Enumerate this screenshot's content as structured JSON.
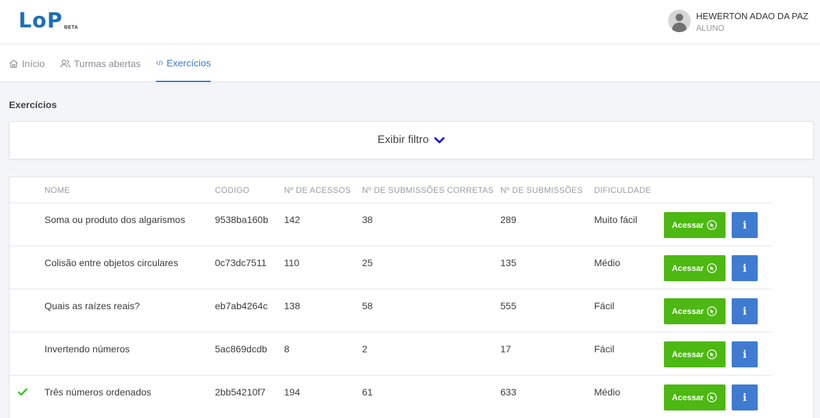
{
  "header": {
    "logo": "LoP",
    "logo_badge": "BETA",
    "user_name": "HEWERTON ADAO DA PAZ",
    "user_role": "ALUNO"
  },
  "nav": {
    "items": [
      {
        "label": "Início",
        "icon": "home-icon"
      },
      {
        "label": "Turmas abertas",
        "icon": "users-icon"
      },
      {
        "label": "Exercícios",
        "icon": "code-icon",
        "active": true
      }
    ]
  },
  "page": {
    "title": "Exercícios",
    "filter_label": "Exibir filtro"
  },
  "table": {
    "columns": [
      "NOME",
      "CÓDIGO",
      "Nº DE ACESSOS",
      "Nº DE SUBMISSÕES CORRETAS",
      "Nº DE SUBMISSÕES",
      "DIFICULDADE"
    ],
    "access_label": "Acessar",
    "info_label": "i",
    "rows": [
      {
        "solved": false,
        "name": "Soma ou produto dos algarismos",
        "code": "9538ba160b",
        "accesses": "142",
        "correct": "38",
        "submissions": "289",
        "difficulty": "Muito fácil"
      },
      {
        "solved": false,
        "name": "Colisão entre objetos circulares",
        "code": "0c73dc7511",
        "accesses": "110",
        "correct": "25",
        "submissions": "135",
        "difficulty": "Médio"
      },
      {
        "solved": false,
        "name": "Quais as raízes reais?",
        "code": "eb7ab4264c",
        "accesses": "138",
        "correct": "58",
        "submissions": "555",
        "difficulty": "Fácil"
      },
      {
        "solved": false,
        "name": "Invertendo números",
        "code": "5ac869dcdb",
        "accesses": "8",
        "correct": "2",
        "submissions": "17",
        "difficulty": "Fácil"
      },
      {
        "solved": true,
        "name": "Três números ordenados",
        "code": "2bb54210f7",
        "accesses": "194",
        "correct": "61",
        "submissions": "633",
        "difficulty": "Médio"
      }
    ]
  },
  "colors": {
    "brand": "#1d6fb8",
    "active_tab": "#3b78c9",
    "access_button": "#4cb811",
    "info_button": "#3f7bd1",
    "check": "#2ecc1f"
  }
}
